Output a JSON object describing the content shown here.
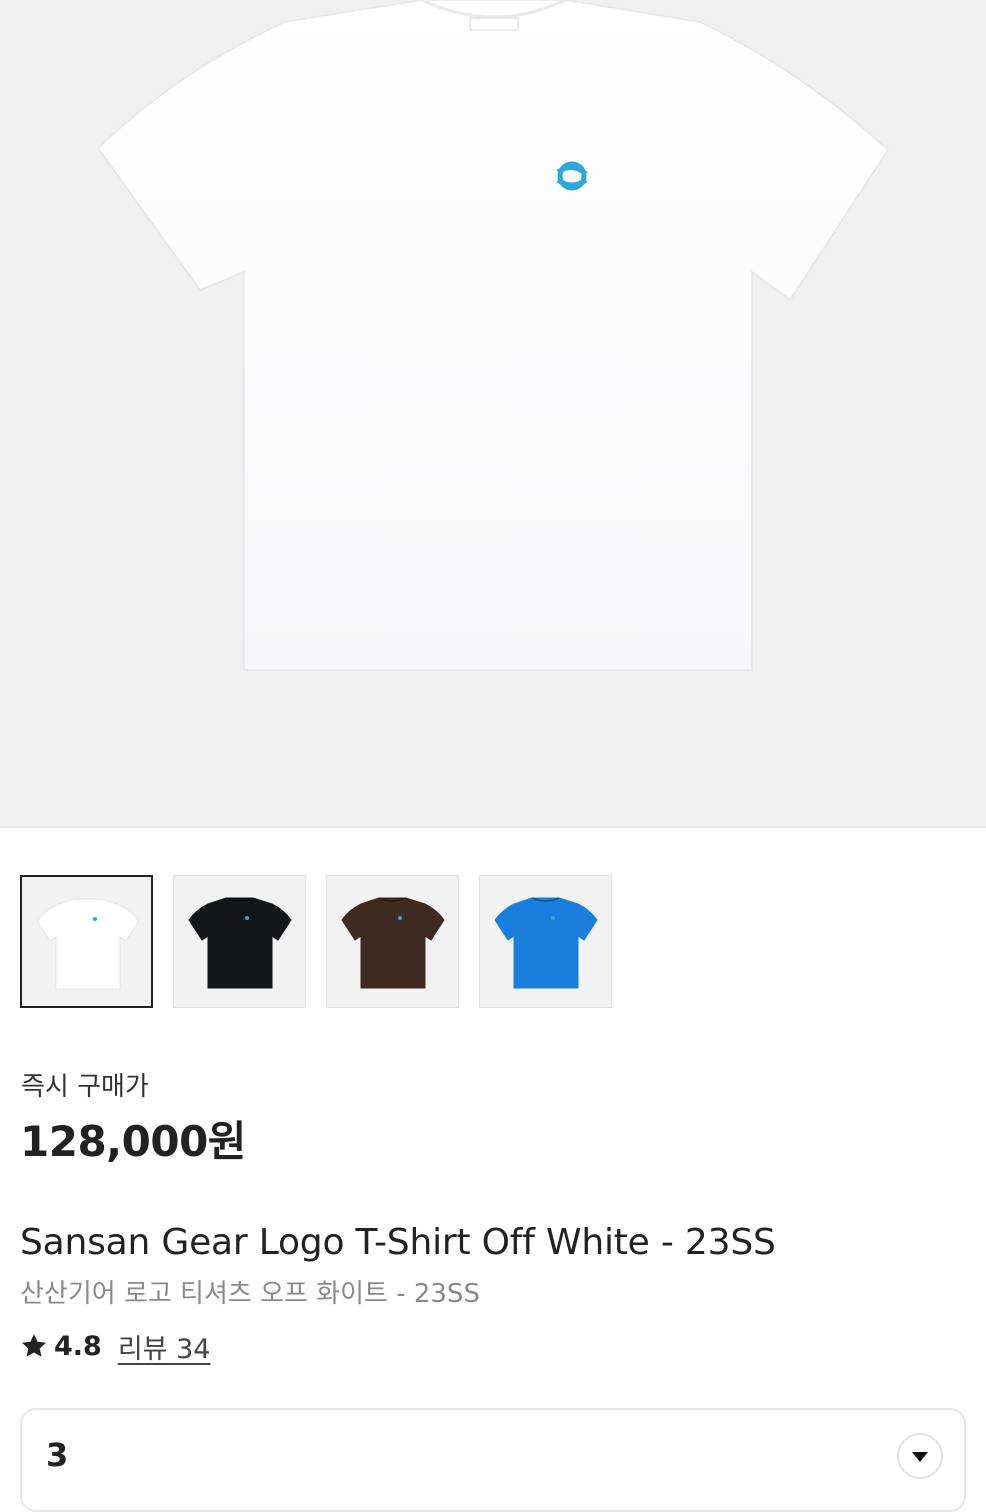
{
  "product_image": {
    "shirt_color": "#ffffff",
    "logo_color": "#2fa6dd",
    "logo_icon": "sansan-gear-logo-icon"
  },
  "thumbnails": [
    {
      "color_name": "white",
      "shirt_color": "#ffffff",
      "selected": true
    },
    {
      "color_name": "black",
      "shirt_color": "#15161a",
      "selected": false
    },
    {
      "color_name": "brown",
      "shirt_color": "#3e2a21",
      "selected": false
    },
    {
      "color_name": "blue",
      "shirt_color": "#1a7fdc",
      "selected": false
    }
  ],
  "price": {
    "label": "즉시 구매가",
    "value": "128,000원"
  },
  "product": {
    "title_en": "Sansan Gear Logo T-Shirt Off White - 23SS",
    "title_ko": "산산기어 로고 티셔츠 오프 화이트 - 23SS"
  },
  "rating": {
    "score": "4.8",
    "review_text": "리뷰 34"
  },
  "size_select": {
    "value": "3"
  },
  "colors": {
    "text_primary": "#222222",
    "text_secondary": "#8a8a8a",
    "hero_background": "#f0f0f0"
  }
}
